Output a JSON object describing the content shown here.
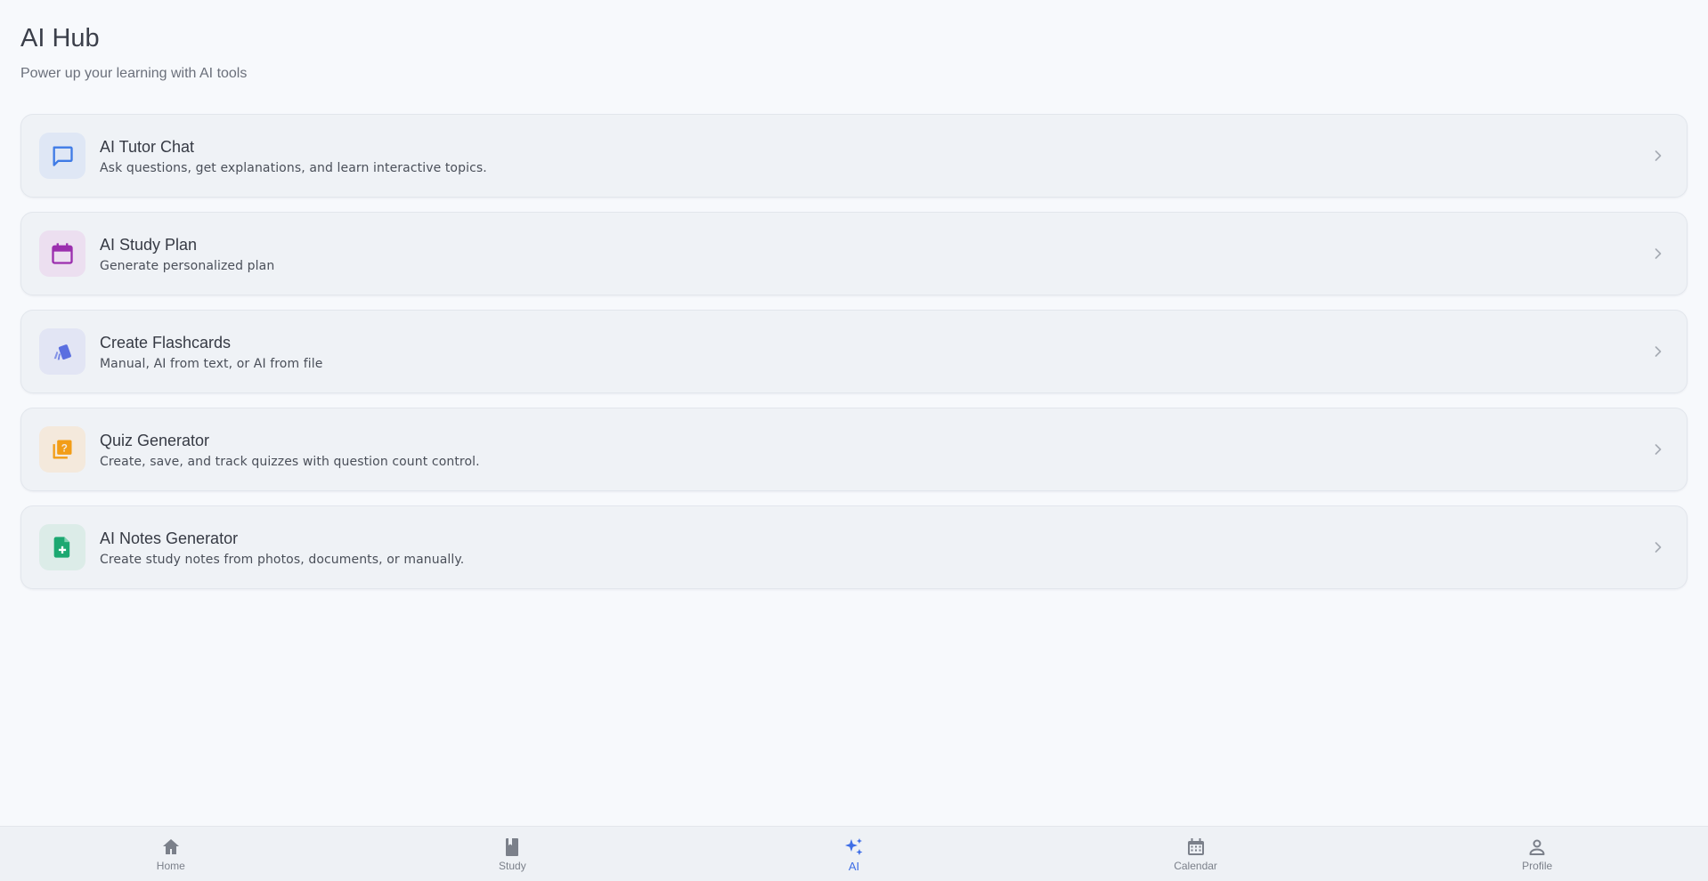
{
  "header": {
    "title": "AI Hub",
    "subtitle": "Power up your learning with AI tools"
  },
  "cards": [
    {
      "title": "AI Tutor Chat",
      "description": "Ask questions, get explanations, and learn interactive topics.",
      "icon": "chat-bubble-icon",
      "color": "#3f7be6",
      "bg": "#dfe7f5"
    },
    {
      "title": "AI Study Plan",
      "description": "Generate personalized plan",
      "icon": "calendar-icon",
      "color": "#9b2fae",
      "bg": "#ecdff0"
    },
    {
      "title": "Create Flashcards",
      "description": "Manual, AI from text, or AI from file",
      "icon": "flashcards-icon",
      "color": "#5b6fe0",
      "bg": "#e2e5f4"
    },
    {
      "title": "Quiz Generator",
      "description": "Create, save, and track quizzes with question count control.",
      "icon": "quiz-icon",
      "color": "#f29d17",
      "bg": "#f4e9dc"
    },
    {
      "title": "AI Notes Generator",
      "description": "Create study notes from photos, documents, or manually.",
      "icon": "note-add-icon",
      "color": "#1ca871",
      "bg": "#dcece8"
    }
  ],
  "nav": {
    "items": [
      {
        "label": "Home",
        "icon": "home-icon"
      },
      {
        "label": "Study",
        "icon": "book-icon"
      },
      {
        "label": "AI",
        "icon": "sparkles-icon",
        "active": true
      },
      {
        "label": "Calendar",
        "icon": "calendar-icon"
      },
      {
        "label": "Profile",
        "icon": "person-icon"
      }
    ],
    "active_color": "#3e6ee6",
    "inactive_color": "#7b808a"
  }
}
